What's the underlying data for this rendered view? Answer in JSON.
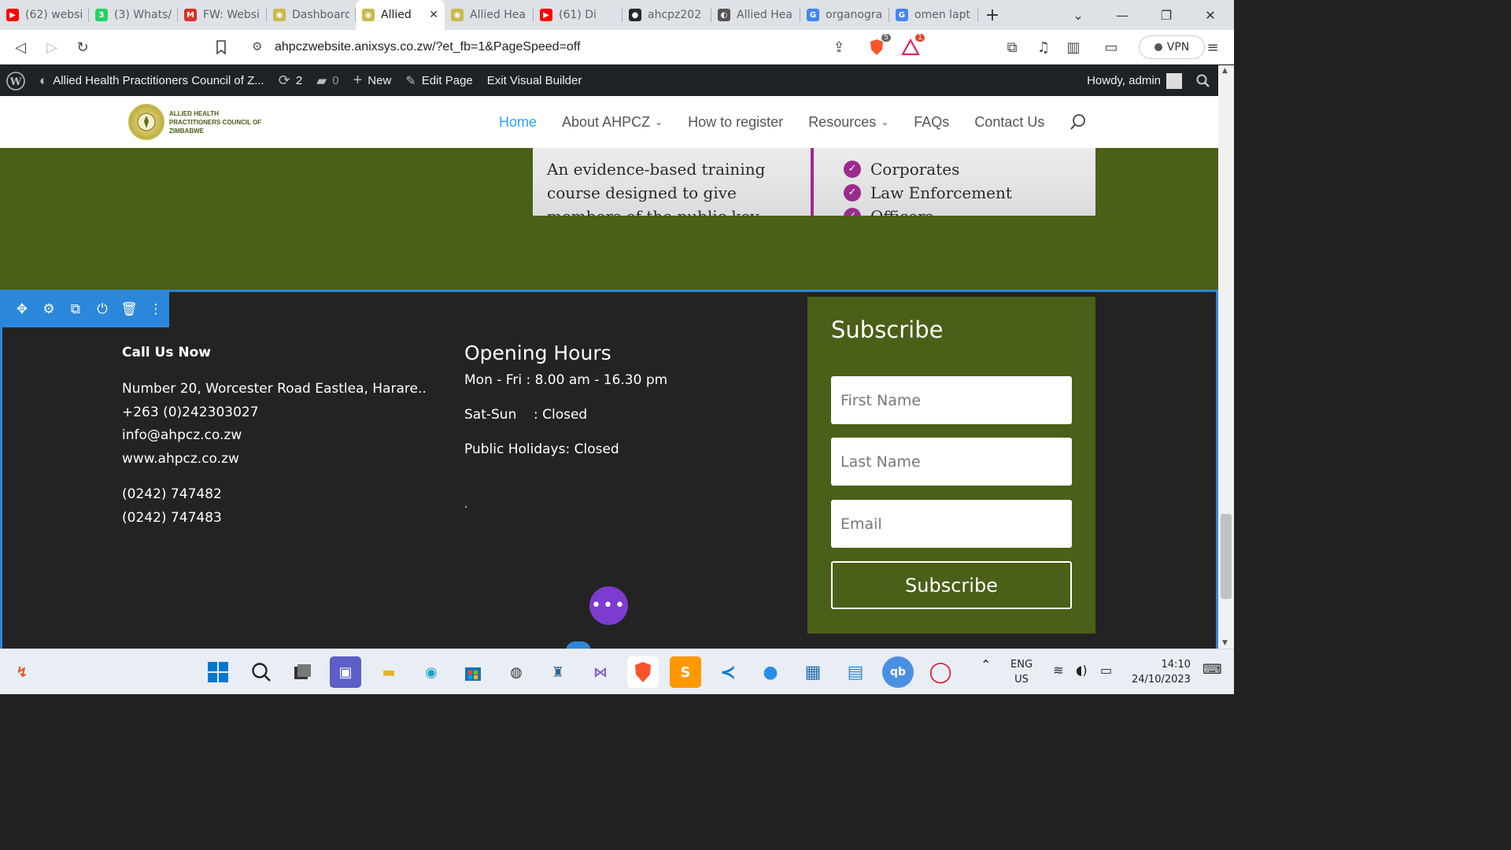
{
  "browser": {
    "tabs": [
      {
        "label": "(62) websi",
        "icon": "youtube-icon",
        "color": "#ff0000"
      },
      {
        "label": "(3) Whats/",
        "icon": "whatsapp-icon",
        "color": "#25d366"
      },
      {
        "label": "FW: Websi",
        "icon": "gmail-icon",
        "color": "#d93025"
      },
      {
        "label": "Dashboard",
        "icon": "ahpcz-favicon",
        "color": "#c9b94e"
      },
      {
        "label": "Allied",
        "icon": "ahpcz-favicon",
        "color": "#c9b94e"
      },
      {
        "label": "Allied Hea",
        "icon": "ahpcz-favicon",
        "color": "#c9b94e"
      },
      {
        "label": "(61) Di",
        "icon": "youtube-icon",
        "color": "#ff0000"
      },
      {
        "label": "ahcpz202",
        "icon": "github-icon",
        "color": "#24292e"
      },
      {
        "label": "Allied Hea",
        "icon": "globe-icon",
        "color": "#555555"
      },
      {
        "label": "organogra",
        "icon": "google-icon",
        "color": "#4285f4"
      },
      {
        "label": "omen lapt",
        "icon": "google-icon",
        "color": "#4285f4"
      }
    ],
    "url": "ahpczwebsite.anixsys.co.zw/?et_fb=1&PageSpeed=off",
    "vpn_label": "VPN",
    "brave_badge": "5",
    "alert_badge": "1"
  },
  "adminbar": {
    "site_name": "Allied Health Practitioners Council of Z...",
    "updates_count": "2",
    "comments_count": "0",
    "new_label": "New",
    "edit_label": "Edit Page",
    "exit_label": "Exit Visual Builder",
    "howdy": "Howdy, admin"
  },
  "header": {
    "logo_text": "ALLIED HEALTH PRACTITIONERS COUNCIL OF ZIMBABWE",
    "nav": [
      {
        "label": "Home"
      },
      {
        "label": "About AHPCZ"
      },
      {
        "label": "How to register"
      },
      {
        "label": "Resources"
      },
      {
        "label": "FAQs"
      },
      {
        "label": "Contact Us"
      }
    ]
  },
  "banner": {
    "left_text": "An evidence-based training course designed to give members of the public key",
    "right_items": [
      "Corporates",
      "Law Enforcement",
      "Officers"
    ]
  },
  "footer": {
    "contact_heading": "Call Us Now",
    "address": "Number 20, Worcester Road Eastlea, Harare..",
    "phone": "+263 (0)242303027",
    "email": "info@ahpcz.co.zw",
    "website": "www.ahpcz.co.zw",
    "phone2": "(0242) 747482",
    "phone3": "(0242) 747483",
    "hours_heading": "Opening Hours",
    "weekday_hours": "Mon - Fri : 8.00 am - 16.30 pm",
    "weekend_hours": "Sat-Sun    : Closed",
    "holiday_hours": "Public Holidays: Closed",
    "stray_dot": "."
  },
  "subscribe": {
    "heading": "Subscribe",
    "first_name_placeholder": "First Name",
    "last_name_placeholder": "Last Name",
    "email_placeholder": "Email",
    "button_label": "Subscribe"
  },
  "taskbar": {
    "lang_top": "ENG",
    "lang_bottom": "US",
    "time": "14:10",
    "date": "24/10/2023"
  }
}
